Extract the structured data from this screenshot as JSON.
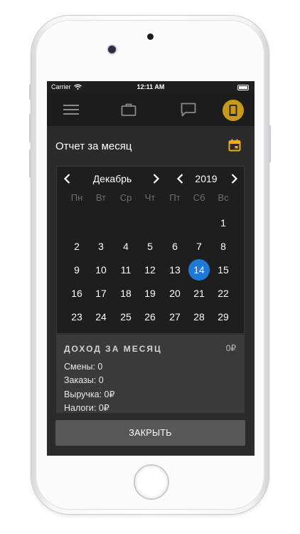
{
  "status_bar": {
    "carrier": "Carrier",
    "time": "12:11 AM"
  },
  "toolbar": {
    "icons": [
      "menu-icon",
      "briefcase-icon",
      "chat-icon",
      "phone-icon"
    ],
    "active_color": "#c99a17"
  },
  "header": {
    "title": "Отчет за месяц",
    "calendar_icon_color": "#e8b114"
  },
  "calendar": {
    "month": "Декабрь",
    "year": "2019",
    "weekdays": [
      "Пн",
      "Вт",
      "Ср",
      "Чт",
      "Пт",
      "Сб",
      "Вс"
    ],
    "weeks": [
      [
        "",
        "",
        "",
        "",
        "",
        "",
        "1"
      ],
      [
        "2",
        "3",
        "4",
        "5",
        "6",
        "7",
        "8"
      ],
      [
        "9",
        "10",
        "11",
        "12",
        "13",
        "14",
        "15"
      ],
      [
        "16",
        "17",
        "18",
        "19",
        "20",
        "21",
        "22"
      ],
      [
        "23",
        "24",
        "25",
        "26",
        "27",
        "28",
        "29"
      ]
    ],
    "selected_day": "14",
    "selected_color": "#1e7ad6"
  },
  "income": {
    "title": "ДОХОД ЗА МЕСЯЦ",
    "total": "0₽",
    "lines": [
      "Смены: 0",
      "Заказы: 0",
      "Выручка: 0₽",
      "Налоги: 0₽"
    ]
  },
  "close_button": {
    "label": "ЗАКРЫТЬ"
  }
}
